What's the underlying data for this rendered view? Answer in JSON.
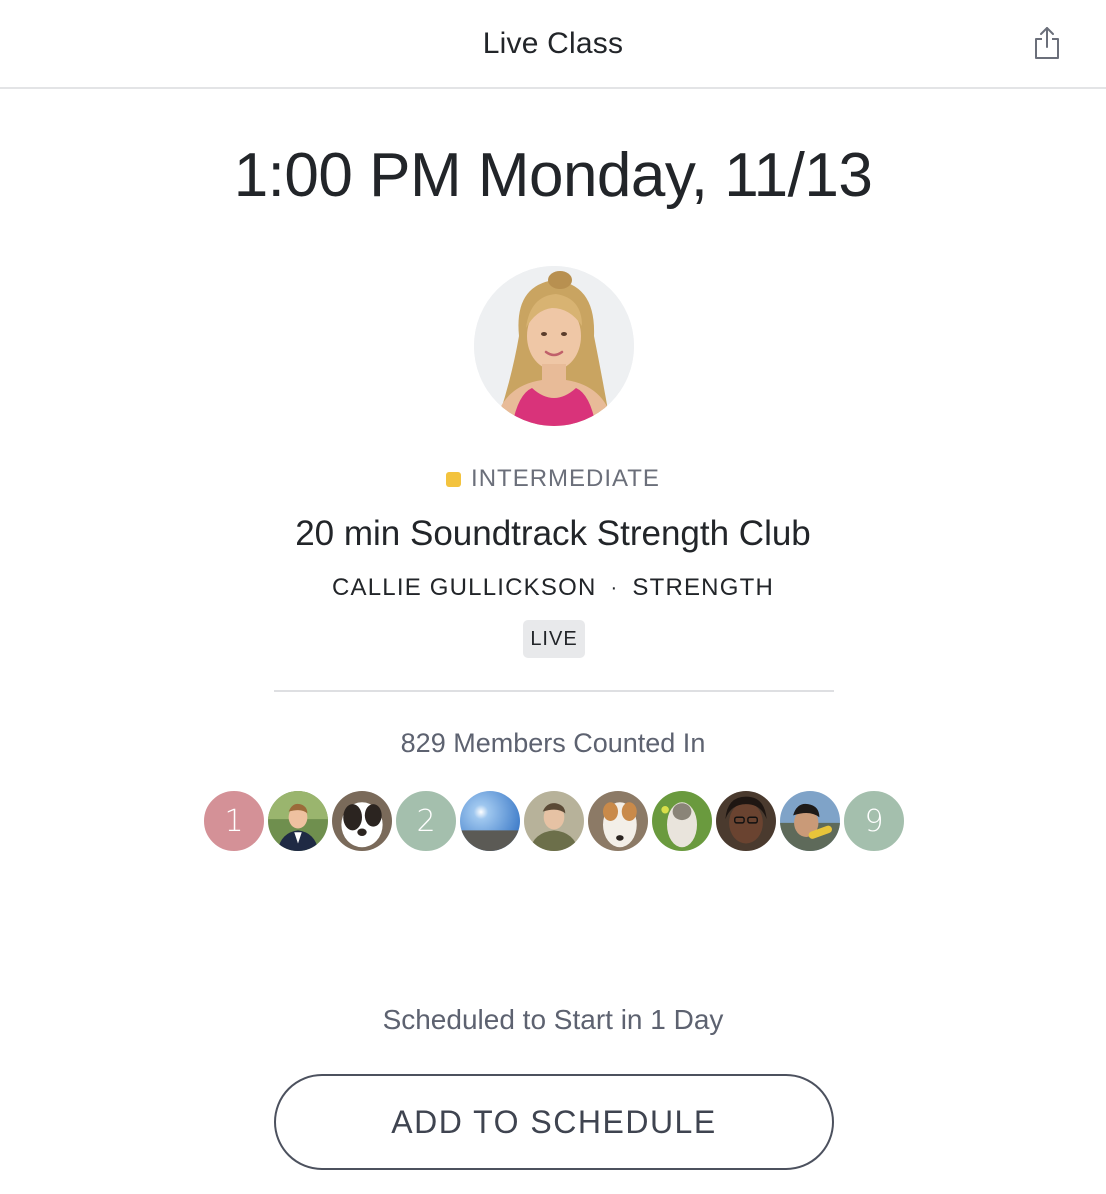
{
  "header": {
    "title": "Live Class",
    "share_icon": "share-icon"
  },
  "class": {
    "datetime": "1:00 PM Monday, 11/13",
    "difficulty": "INTERMEDIATE",
    "difficulty_color": "#f3c33e",
    "title": "20 min Soundtrack Strength Club",
    "instructor": "CALLIE GULLICKSON",
    "separator": "·",
    "category": "STRENGTH",
    "badge": "LIVE"
  },
  "members": {
    "count_text": "829 Members Counted In",
    "avatars": [
      {
        "type": "initial",
        "text": "1",
        "color": "#d49197"
      },
      {
        "type": "photo",
        "text": ""
      },
      {
        "type": "photo",
        "text": ""
      },
      {
        "type": "initial",
        "text": "2",
        "color": "#a4bfad"
      },
      {
        "type": "photo",
        "text": ""
      },
      {
        "type": "photo",
        "text": ""
      },
      {
        "type": "photo",
        "text": ""
      },
      {
        "type": "photo",
        "text": ""
      },
      {
        "type": "photo",
        "text": ""
      },
      {
        "type": "photo",
        "text": ""
      },
      {
        "type": "initial",
        "text": "9",
        "color": "#a4bfad"
      }
    ]
  },
  "schedule": {
    "status": "Scheduled to Start in 1 Day",
    "button_label": "ADD TO SCHEDULE"
  }
}
